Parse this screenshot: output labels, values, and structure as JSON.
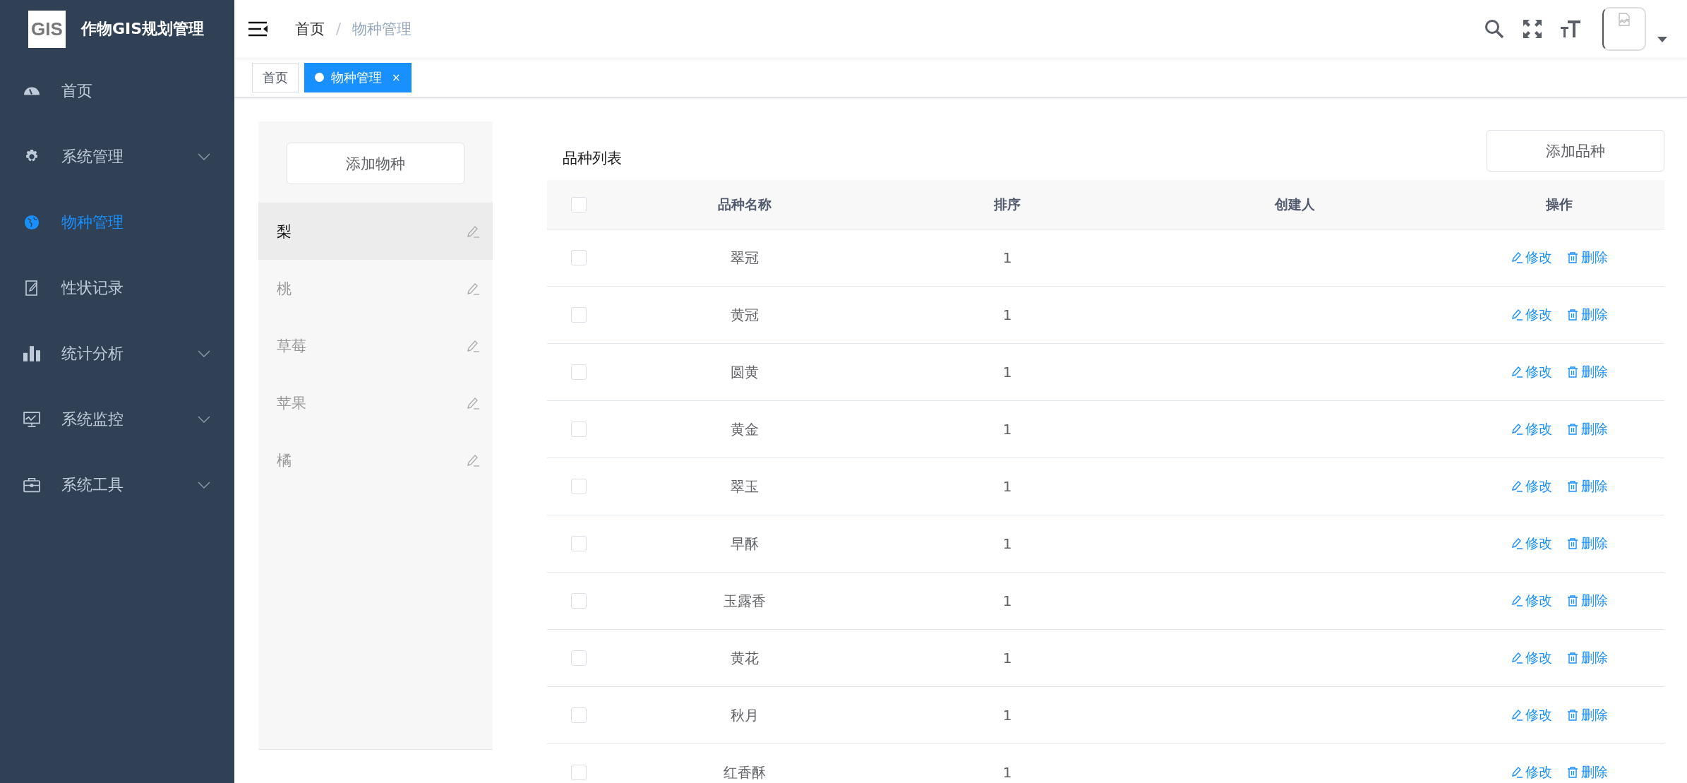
{
  "sidebar": {
    "logo": "GIS",
    "title": "作物GIS规划管理",
    "items": [
      {
        "label": "首页",
        "expandable": false,
        "selected": false
      },
      {
        "label": "系统管理",
        "expandable": true,
        "selected": false
      },
      {
        "label": "物种管理",
        "expandable": false,
        "selected": true
      },
      {
        "label": "性状记录",
        "expandable": false,
        "selected": false
      },
      {
        "label": "统计分析",
        "expandable": true,
        "selected": false
      },
      {
        "label": "系统监控",
        "expandable": true,
        "selected": false
      },
      {
        "label": "系统工具",
        "expandable": true,
        "selected": false
      }
    ]
  },
  "breadcrumb": {
    "separator": "/",
    "items": [
      "首页",
      "物种管理"
    ]
  },
  "tabs": [
    {
      "label": "首页",
      "selected": false,
      "closable": false
    },
    {
      "label": "物种管理",
      "selected": true,
      "closable": true,
      "close": "×"
    }
  ],
  "species_panel": {
    "add_button": "添加物种",
    "items": [
      {
        "label": "梨",
        "selected": true
      },
      {
        "label": "桃",
        "selected": false
      },
      {
        "label": "草莓",
        "selected": false
      },
      {
        "label": "苹果",
        "selected": false
      },
      {
        "label": "橘",
        "selected": false
      }
    ]
  },
  "table": {
    "title": "品种列表",
    "add_button": "添加品种",
    "select_all": false,
    "columns": [
      "品种名称",
      "排序",
      "创建人",
      "操作"
    ],
    "rows": [
      {
        "checked": false,
        "name": "翠冠",
        "order": "1",
        "creator": "",
        "edit": "修改",
        "delete": "删除"
      },
      {
        "checked": false,
        "name": "黄冠",
        "order": "1",
        "creator": "",
        "edit": "修改",
        "delete": "删除"
      },
      {
        "checked": false,
        "name": "圆黄",
        "order": "1",
        "creator": "",
        "edit": "修改",
        "delete": "删除"
      },
      {
        "checked": false,
        "name": "黄金",
        "order": "1",
        "creator": "",
        "edit": "修改",
        "delete": "删除"
      },
      {
        "checked": false,
        "name": "翠玉",
        "order": "1",
        "creator": "",
        "edit": "修改",
        "delete": "删除"
      },
      {
        "checked": false,
        "name": "早酥",
        "order": "1",
        "creator": "",
        "edit": "修改",
        "delete": "删除"
      },
      {
        "checked": false,
        "name": "玉露香",
        "order": "1",
        "creator": "",
        "edit": "修改",
        "delete": "删除"
      },
      {
        "checked": false,
        "name": "黄花",
        "order": "1",
        "creator": "",
        "edit": "修改",
        "delete": "删除"
      },
      {
        "checked": false,
        "name": "秋月",
        "order": "1",
        "creator": "",
        "edit": "修改",
        "delete": "删除"
      },
      {
        "checked": false,
        "name": "红香酥",
        "order": "1",
        "creator": "",
        "edit": "修改",
        "delete": "删除"
      }
    ]
  }
}
